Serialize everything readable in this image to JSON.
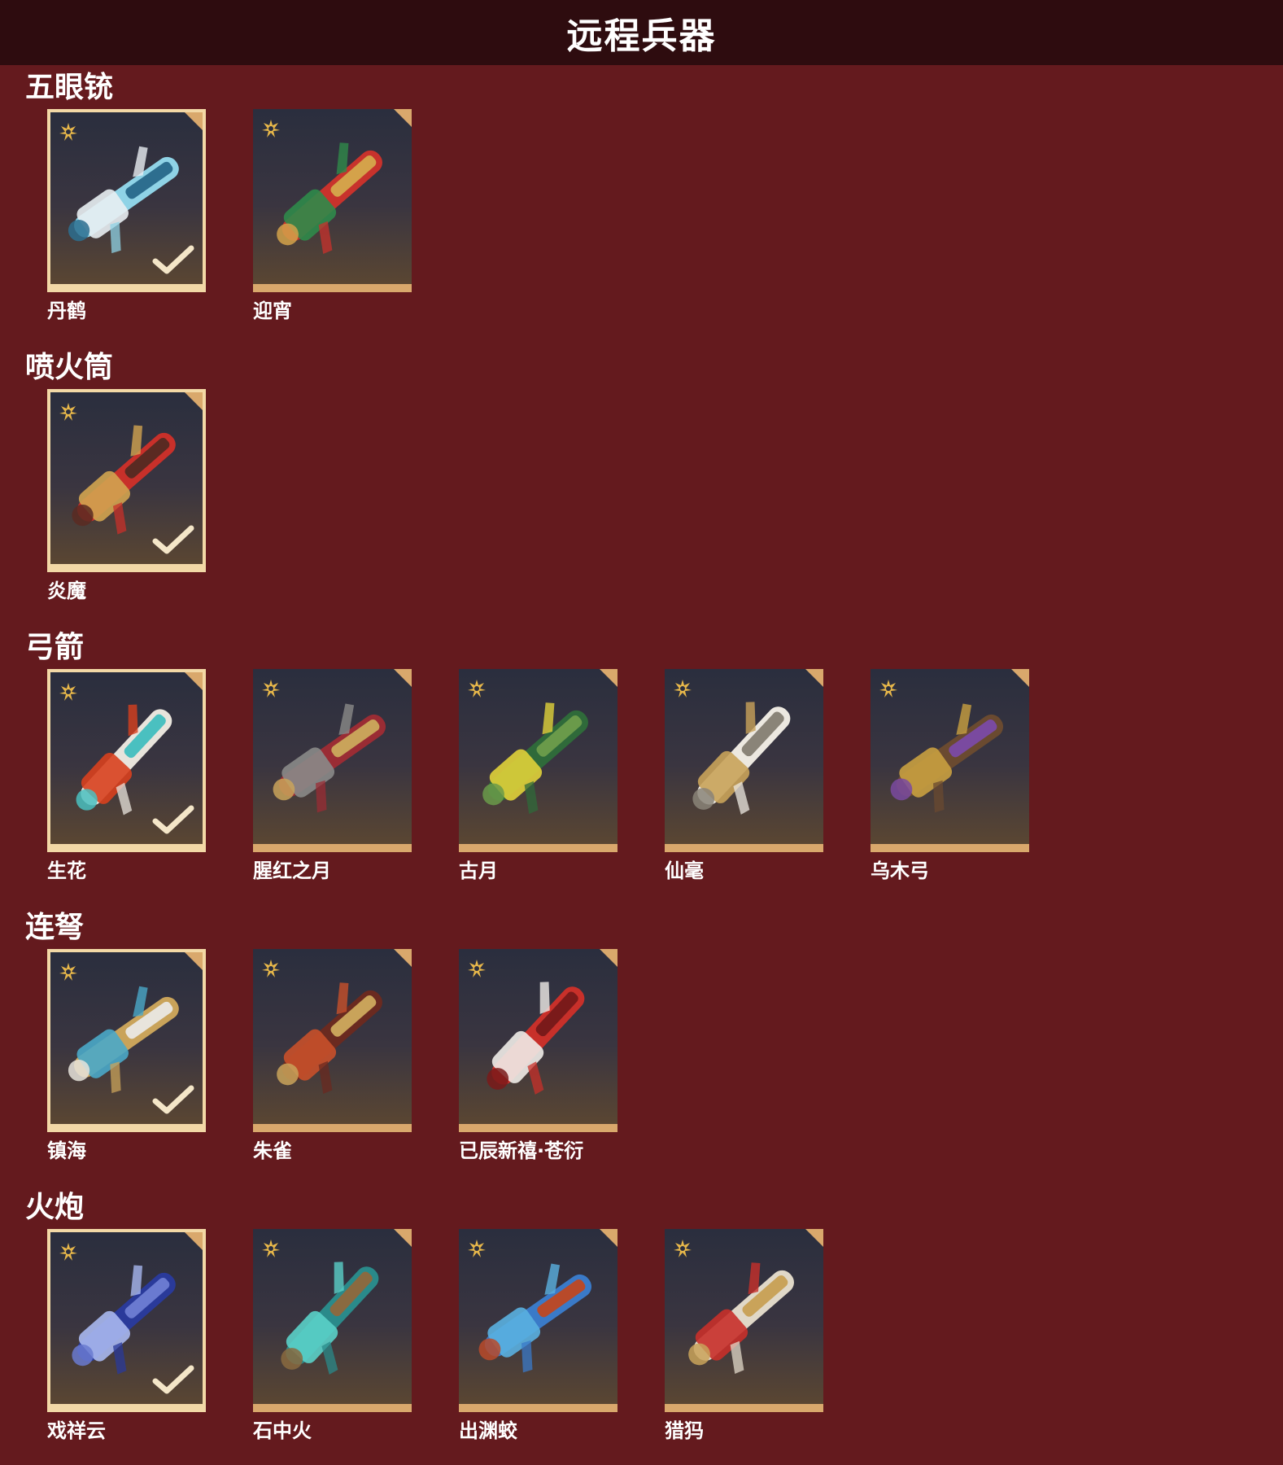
{
  "header": {
    "title": "远程兵器"
  },
  "colors": {
    "background": "#641a1e",
    "header_bg": "#2e0c0f",
    "frame_accent": "#d9a86c",
    "selected_border": "#f2d8a6"
  },
  "sections": [
    {
      "title": "五眼铳",
      "items": [
        {
          "label": "丹鹤",
          "selected": true,
          "icon": "blue-white-crane-gun-icon"
        },
        {
          "label": "迎宵",
          "selected": false,
          "icon": "red-dragon-gun-icon"
        }
      ]
    },
    {
      "title": "喷火筒",
      "items": [
        {
          "label": "炎魔",
          "selected": true,
          "icon": "red-flame-tube-icon"
        }
      ]
    },
    {
      "title": "弓箭",
      "items": [
        {
          "label": "生花",
          "selected": true,
          "icon": "flower-bow-icon"
        },
        {
          "label": "腥红之月",
          "selected": false,
          "icon": "crimson-moon-bow-icon"
        },
        {
          "label": "古月",
          "selected": false,
          "icon": "ancient-moon-bow-icon"
        },
        {
          "label": "仙毫",
          "selected": false,
          "icon": "white-feather-bow-icon"
        },
        {
          "label": "乌木弓",
          "selected": false,
          "icon": "ebony-bow-icon"
        }
      ]
    },
    {
      "title": "连弩",
      "items": [
        {
          "label": "镇海",
          "selected": true,
          "icon": "sea-crossbow-icon"
        },
        {
          "label": "朱雀",
          "selected": false,
          "icon": "vermilion-bird-crossbow-icon"
        },
        {
          "label": "已辰新禧·苍衍",
          "selected": false,
          "icon": "red-white-crossbow-icon"
        }
      ]
    },
    {
      "title": "火炮",
      "items": [
        {
          "label": "戏祥云",
          "selected": true,
          "icon": "cloud-cannon-icon"
        },
        {
          "label": "石中火",
          "selected": false,
          "icon": "teal-stone-cannon-icon"
        },
        {
          "label": "出渊蛟",
          "selected": false,
          "icon": "blue-dragon-cannon-icon"
        },
        {
          "label": "猎犸",
          "selected": false,
          "icon": "red-mammoth-cannon-icon"
        }
      ]
    }
  ]
}
